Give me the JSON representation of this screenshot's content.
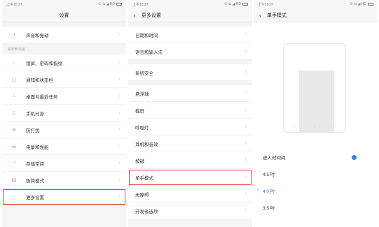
{
  "panel1": {
    "status_time": "上午10:27",
    "status_icons": "✆ ⇆ ◢ HD",
    "title": "设置",
    "item_top": {
      "label": "声音和振动",
      "icon": "sound-icon"
    },
    "section_label": "系统和设备",
    "items": [
      {
        "label": "锁屏、密码和指纹",
        "icon": "lock-icon"
      },
      {
        "label": "通知和状态栏",
        "icon": "notification-icon"
      },
      {
        "label": "桌面与最近任务",
        "icon": "home-icon"
      },
      {
        "label": "手机分身",
        "icon": "phone-clone-icon"
      },
      {
        "label": "防打扰",
        "icon": "do-not-disturb-icon"
      },
      {
        "label": "电量和性能",
        "icon": "battery-icon"
      },
      {
        "label": "存储空间",
        "icon": "storage-icon"
      },
      {
        "label": "极简模式",
        "icon": "simple-mode-icon"
      },
      {
        "label": "更多设置",
        "icon": "more-icon"
      }
    ],
    "highlight_color": "#e53935"
  },
  "panel2": {
    "status_time": "上午10:27",
    "status_icons": "✆ ⇆ ◢ HD",
    "title": "更多设置",
    "items": [
      {
        "label": "日期和时间"
      },
      {
        "label": "语言和输入法"
      },
      {
        "label": "系统安全"
      },
      {
        "label": "悬浮球"
      },
      {
        "label": "截屏"
      },
      {
        "label": "呼吸灯"
      },
      {
        "label": "耳机和音效"
      },
      {
        "label": "按键"
      },
      {
        "label": "单手模式"
      },
      {
        "label": "无障碍"
      },
      {
        "label": "开发者选项"
      }
    ]
  },
  "panel3": {
    "status_time": "上午10:27",
    "status_icons": "✆ ⇆ ◢ HD",
    "title": "单手模式",
    "enter_label": "进入时间间",
    "options": [
      {
        "label": "4.5 吋",
        "selected": false
      },
      {
        "label": "4.0 吋",
        "selected": true
      },
      {
        "label": "3.5 吋",
        "selected": false
      }
    ],
    "accent_color": "#2e7bd8"
  }
}
